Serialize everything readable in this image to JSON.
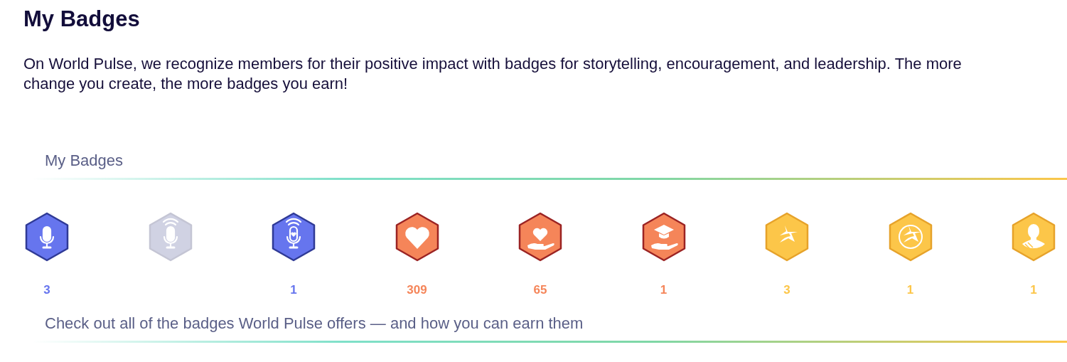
{
  "title": "My Badges",
  "intro": "On World Pulse, we recognize members for their positive impact with badges for storytelling, encouragement, and leadership. The more change you create, the more badges you earn!",
  "badges_section": {
    "heading": "My Badges",
    "badges": [
      {
        "kind": "mic",
        "color": "#6675ee",
        "count": "3"
      },
      {
        "kind": "podcast",
        "color": "#d0d2e3"
      },
      {
        "kind": "podcast-heart",
        "color": "#6675ee",
        "count": "1"
      },
      {
        "kind": "heart",
        "color": "#f58559",
        "count": "309"
      },
      {
        "kind": "heart-hand",
        "color": "#f58559",
        "count": "65"
      },
      {
        "kind": "cap-hand",
        "color": "#f58559",
        "count": "1"
      },
      {
        "kind": "star",
        "color": "#fcc649",
        "count": "3"
      },
      {
        "kind": "star-circle",
        "color": "#fcc649",
        "count": "1"
      },
      {
        "kind": "person",
        "color": "#fcc649",
        "count": "1"
      }
    ]
  },
  "link_heading": "Check out all of the badges World Pulse offers — and how you can earn them"
}
